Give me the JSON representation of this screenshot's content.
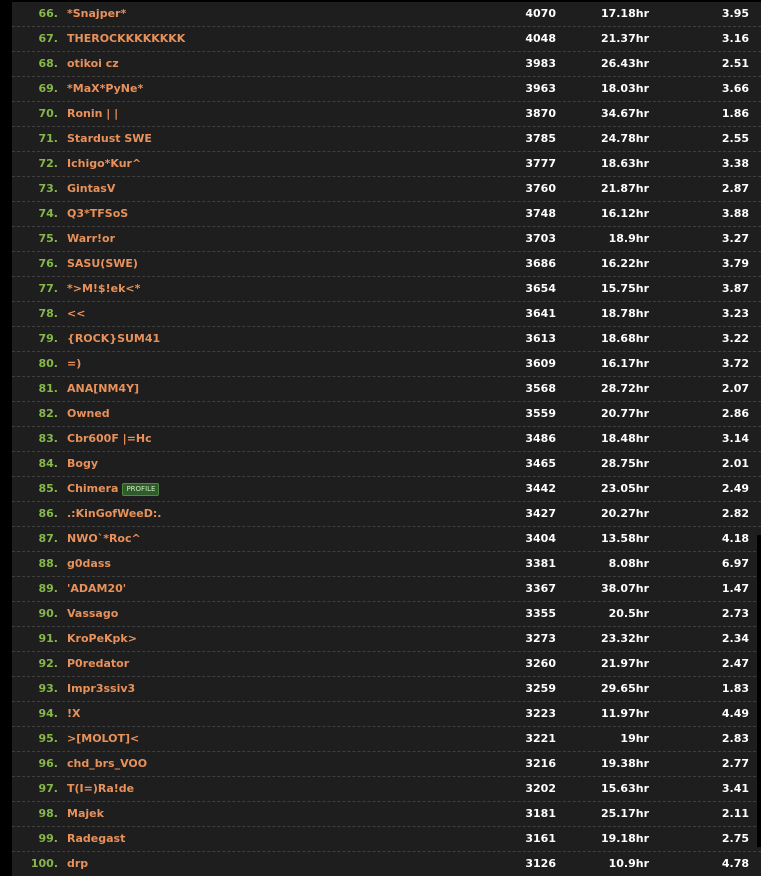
{
  "players": [
    {
      "rank": "66.",
      "name": "*Snajper*",
      "score": "4070",
      "time": "17.18hr",
      "ratio": "3.95"
    },
    {
      "rank": "67.",
      "name": "THEROCKKKKKKKK",
      "score": "4048",
      "time": "21.37hr",
      "ratio": "3.16"
    },
    {
      "rank": "68.",
      "name": "otikoi cz",
      "score": "3983",
      "time": "26.43hr",
      "ratio": "2.51"
    },
    {
      "rank": "69.",
      "name": "*MaX*PyNe*",
      "score": "3963",
      "time": "18.03hr",
      "ratio": "3.66"
    },
    {
      "rank": "70.",
      "name": "Ronin | |",
      "score": "3870",
      "time": "34.67hr",
      "ratio": "1.86"
    },
    {
      "rank": "71.",
      "name": "Stardust SWE",
      "score": "3785",
      "time": "24.78hr",
      "ratio": "2.55"
    },
    {
      "rank": "72.",
      "name": "Ichigo*Kur^",
      "score": "3777",
      "time": "18.63hr",
      "ratio": "3.38"
    },
    {
      "rank": "73.",
      "name": "GintasV",
      "score": "3760",
      "time": "21.87hr",
      "ratio": "2.87"
    },
    {
      "rank": "74.",
      "name": "Q3*TFSoS",
      "score": "3748",
      "time": "16.12hr",
      "ratio": "3.88"
    },
    {
      "rank": "75.",
      "name": "Warr!or",
      "score": "3703",
      "time": "18.9hr",
      "ratio": "3.27"
    },
    {
      "rank": "76.",
      "name": "SASU(SWE)",
      "score": "3686",
      "time": "16.22hr",
      "ratio": "3.79"
    },
    {
      "rank": "77.",
      "name": "*>M!$!ek<*",
      "score": "3654",
      "time": "15.75hr",
      "ratio": "3.87"
    },
    {
      "rank": "78.",
      "name": "<<",
      "score": "3641",
      "time": "18.78hr",
      "ratio": "3.23"
    },
    {
      "rank": "79.",
      "name": "{ROCK}SUM41",
      "score": "3613",
      "time": "18.68hr",
      "ratio": "3.22"
    },
    {
      "rank": "80.",
      "name": "=)",
      "score": "3609",
      "time": "16.17hr",
      "ratio": "3.72"
    },
    {
      "rank": "81.",
      "name": "ANA[NM4Y]",
      "score": "3568",
      "time": "28.72hr",
      "ratio": "2.07"
    },
    {
      "rank": "82.",
      "name": "Owned",
      "score": "3559",
      "time": "20.77hr",
      "ratio": "2.86"
    },
    {
      "rank": "83.",
      "name": "Cbr600F |=Hc",
      "score": "3486",
      "time": "18.48hr",
      "ratio": "3.14"
    },
    {
      "rank": "84.",
      "name": "Bogy",
      "score": "3465",
      "time": "28.75hr",
      "ratio": "2.01"
    },
    {
      "rank": "85.",
      "name": "Chimera",
      "badge": "PROFILE",
      "score": "3442",
      "time": "23.05hr",
      "ratio": "2.49"
    },
    {
      "rank": "86.",
      "name": ".:KinGofWeeD:.",
      "score": "3427",
      "time": "20.27hr",
      "ratio": "2.82"
    },
    {
      "rank": "87.",
      "name": "NWO`*Roc^",
      "score": "3404",
      "time": "13.58hr",
      "ratio": "4.18"
    },
    {
      "rank": "88.",
      "name": "g0dass",
      "score": "3381",
      "time": "8.08hr",
      "ratio": "6.97"
    },
    {
      "rank": "89.",
      "name": "'ADAM20'",
      "score": "3367",
      "time": "38.07hr",
      "ratio": "1.47"
    },
    {
      "rank": "90.",
      "name": "Vassago",
      "score": "3355",
      "time": "20.5hr",
      "ratio": "2.73"
    },
    {
      "rank": "91.",
      "name": "KroPeKpk>",
      "score": "3273",
      "time": "23.32hr",
      "ratio": "2.34"
    },
    {
      "rank": "92.",
      "name": "P0redator",
      "score": "3260",
      "time": "21.97hr",
      "ratio": "2.47"
    },
    {
      "rank": "93.",
      "name": "Impr3ssiv3",
      "score": "3259",
      "time": "29.65hr",
      "ratio": "1.83"
    },
    {
      "rank": "94.",
      "name": "!X",
      "score": "3223",
      "time": "11.97hr",
      "ratio": "4.49"
    },
    {
      "rank": "95.",
      "name": ">[MOLOT]<",
      "score": "3221",
      "time": "19hr",
      "ratio": "2.83"
    },
    {
      "rank": "96.",
      "name": "chd_brs_VOO",
      "score": "3216",
      "time": "19.38hr",
      "ratio": "2.77"
    },
    {
      "rank": "97.",
      "name": "T(I=)Ra!de",
      "score": "3202",
      "time": "15.63hr",
      "ratio": "3.41"
    },
    {
      "rank": "98.",
      "name": "Majek",
      "score": "3181",
      "time": "25.17hr",
      "ratio": "2.11"
    },
    {
      "rank": "99.",
      "name": "Radegast",
      "score": "3161",
      "time": "19.18hr",
      "ratio": "2.75"
    },
    {
      "rank": "100.",
      "name": "drp",
      "score": "3126",
      "time": "10.9hr",
      "ratio": "4.78"
    }
  ]
}
